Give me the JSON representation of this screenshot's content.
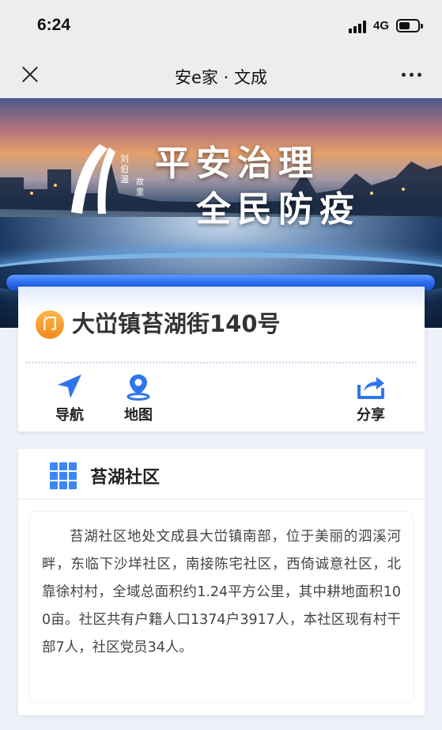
{
  "status_bar": {
    "time": "6:24",
    "network": "4G"
  },
  "nav": {
    "title": "安e家 · 文成"
  },
  "banner": {
    "slogan_line1": "平安治理",
    "slogan_line2": "全民防疫",
    "logo_text": "刘伯温",
    "logo_text2": "故里"
  },
  "address": {
    "icon_glyph": "门",
    "title": "大峃镇苔湖街140号",
    "actions": [
      {
        "label": "导航",
        "icon": "navigation-arrow-icon"
      },
      {
        "label": "地图",
        "icon": "map-pin-icon"
      },
      {
        "label": "分享",
        "icon": "share-icon"
      }
    ]
  },
  "community": {
    "title": "苔湖社区",
    "icon": "grid-icon",
    "description": "苔湖社区地处文成县大峃镇南部，位于美丽的泗溪河畔，东临下沙垟社区，南接陈宅社区，西倚诚意社区，北靠徐村村，全域总面积约1.24平方公里，其中耕地面积100亩。社区共有户籍人口1374户3917人，本社区现有村干部7人，社区党员34人。"
  },
  "colors": {
    "accent_blue": "#2a6cf0",
    "orange": "#f28a1a"
  }
}
